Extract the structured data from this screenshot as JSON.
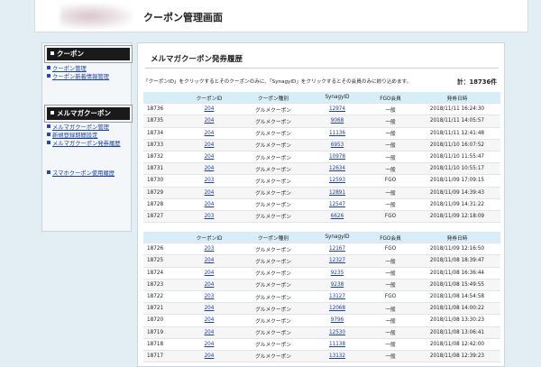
{
  "header": {
    "title": "クーポン管理画面"
  },
  "sidebar": {
    "sections": [
      {
        "title": "クーポン",
        "links": [
          "クーポン管理",
          "クーポン新着情報管理"
        ]
      },
      {
        "title": "メルマガクーポン",
        "links": [
          "メルマガクーポン管理",
          "新規登録期間設定",
          "メルマガクーポン発券履歴"
        ]
      }
    ],
    "extra_link": "スマホクーポン使用履歴"
  },
  "main": {
    "title": "メルマガクーポン発券履歴",
    "note": "「クーポンID」をクリックするとそのクーポンのみに、「SynagyID」をクリックするとその会員のみに絞り込めます。",
    "total": "計：18736件",
    "columns": [
      "",
      "クーポンID",
      "クーポン種別",
      "SynagyID",
      "FGO会員",
      "発券日時"
    ],
    "rows_a": [
      [
        "18736",
        "204",
        "グルメクーポン",
        "12974",
        "一般",
        "2018/11/11 16:24:30"
      ],
      [
        "18735",
        "204",
        "グルメクーポン",
        "9068",
        "一般",
        "2018/11/11 14:05:57"
      ],
      [
        "18734",
        "204",
        "グルメクーポン",
        "11136",
        "一般",
        "2018/11/11 12:41:48"
      ],
      [
        "18733",
        "204",
        "グルメクーポン",
        "6953",
        "一般",
        "2018/11/10 16:07:52"
      ],
      [
        "18732",
        "204",
        "グルメクーポン",
        "10978",
        "一般",
        "2018/11/10 11:55:47"
      ],
      [
        "18731",
        "204",
        "グルメクーポン",
        "12634",
        "一般",
        "2018/11/10 10:55:17"
      ],
      [
        "18730",
        "203",
        "グルメクーポン",
        "12593",
        "FGO",
        "2018/11/09 17:09:15"
      ],
      [
        "18729",
        "204",
        "グルメクーポン",
        "12891",
        "一般",
        "2018/11/09 14:39:43"
      ],
      [
        "18728",
        "204",
        "グルメクーポン",
        "12547",
        "一般",
        "2018/11/09 14:31:22"
      ],
      [
        "18727",
        "203",
        "グルメクーポン",
        "6626",
        "FGO",
        "2018/11/09 12:18:09"
      ]
    ],
    "rows_b": [
      [
        "18726",
        "203",
        "グルメクーポン",
        "12167",
        "FGO",
        "2018/11/09 12:16:50"
      ],
      [
        "18725",
        "204",
        "グルメクーポン",
        "12327",
        "一般",
        "2018/11/08 18:39:47"
      ],
      [
        "18724",
        "204",
        "グルメクーポン",
        "9235",
        "一般",
        "2018/11/08 16:36:44"
      ],
      [
        "18723",
        "204",
        "グルメクーポン",
        "9238",
        "一般",
        "2018/11/08 15:49:55"
      ],
      [
        "18722",
        "203",
        "グルメクーポン",
        "13127",
        "FGO",
        "2018/11/08 14:54:58"
      ],
      [
        "18721",
        "204",
        "グルメクーポン",
        "12068",
        "一般",
        "2018/11/08 14:00:22"
      ],
      [
        "18720",
        "204",
        "グルメクーポン",
        "9796",
        "一般",
        "2018/11/08 13:30:23"
      ],
      [
        "18719",
        "204",
        "グルメクーポン",
        "12530",
        "一般",
        "2018/11/08 13:06:41"
      ],
      [
        "18718",
        "204",
        "グルメクーポン",
        "11138",
        "一般",
        "2018/11/08 12:42:00"
      ],
      [
        "18717",
        "204",
        "グルメクーポン",
        "13132",
        "一般",
        "2018/11/08 12:39:23"
      ]
    ]
  }
}
